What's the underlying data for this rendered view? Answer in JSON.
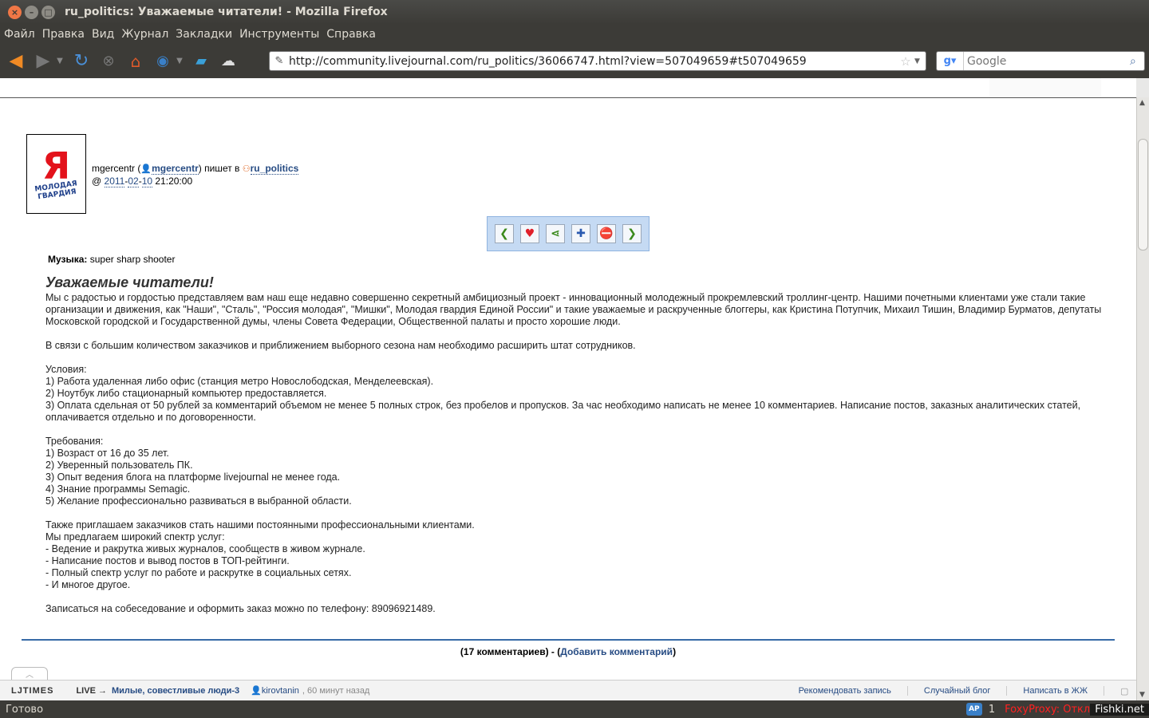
{
  "window": {
    "title": "ru_politics: Уважаемые читатели! - Mozilla Firefox"
  },
  "menu": [
    "Файл",
    "Правка",
    "Вид",
    "Журнал",
    "Закладки",
    "Инструменты",
    "Справка"
  ],
  "navbar": {
    "url": "http://community.livejournal.com/ru_politics/36066747.html?view=507049659#t507049659",
    "search_placeholder": "Google"
  },
  "post": {
    "poster_name": "mgercentr",
    "poster_user": "mgercentr",
    "writes_in": "пишет в",
    "community": "ru_politics",
    "date_prefix": "@",
    "date_year": "2011",
    "date_month": "02",
    "date_day": "10",
    "time": "21:20:00",
    "music_label": "Музыка:",
    "music_value": "super sharp shooter",
    "subject": "Уважаемые читатели!",
    "paragraphs": [
      [
        "Мы с радостью и гордостью представляем вам наш еще недавно совершенно секретный амбициозный проект - инновационный молодежный прокремлевский троллинг-центр. Нашими почетными клиентами уже стали такие организации и движения, как \"Наши\", \"Сталь\", \"Россия молодая\", \"Мишки\", Молодая гвардия Единой России\" и такие уважаемые и раскрученные блоггеры, как Кристина Потупчик, Михаил Тишин, Владимир Бурматов, депутаты Московской городской и Государственной думы, члены Совета Федерации, Общественной палаты и просто хорошие люди."
      ],
      [
        "В связи с большим количеством заказчиков и приближением выборного сезона нам необходимо расширить штат сотрудников."
      ],
      [
        "Условия:",
        "1) Работа удаленная либо офис (станция метро Новослободская, Менделеевская).",
        "2) Ноутбук либо стационарный компьютер предоставляется.",
        "3) Оплата сдельная от 50 рублей за комментарий объемом не менее 5 полных строк, без пробелов и пропусков. За час необходимо написать не менее 10 комментариев. Написание постов, заказных аналитических статей, оплачивается отдельно и по договоренности."
      ],
      [
        "Требования:",
        "1) Возраст от 16 до 35 лет.",
        "2) Уверенный пользователь ПК.",
        "3) Опыт ведения блога на платформе livejournal не менее года.",
        "4) Знание программы Semagic.",
        "5) Желание профессионально развиваться в выбранной области."
      ],
      [
        "Также приглашаем заказчиков стать нашими постоянными профессиональными клиентами.",
        "Мы предлагаем широкий спектр услуг:",
        "- Ведение и ракрутка живых журналов, сообществ в живом журнале.",
        "- Написание постов и вывод постов в ТОП-рейтинги.",
        "- Полный спектр услуг по работе и раскрутке в социальных сетях.",
        "- И многое другое."
      ],
      [
        "Записаться на собеседование и оформить заказ можно по телефону: 89096921489."
      ]
    ]
  },
  "comments": {
    "count_text": "(17 комментариев) - (",
    "add_text": "Добавить комментарий",
    "close": ")"
  },
  "ljbar": {
    "brand": "LJTIMES",
    "live": "LIVE →",
    "live_link": "Милые, совестливые люди-3",
    "user": "kirovtanin",
    "ago": ", 60 минут назад",
    "recommend": "Рекомендовать запись",
    "random": "Случайный блог",
    "write": "Написать в ЖЖ"
  },
  "status": {
    "text": "Готово",
    "count": "1",
    "foxy": "FoxyProxy: Откл",
    "fishki": "Fishki.net"
  }
}
